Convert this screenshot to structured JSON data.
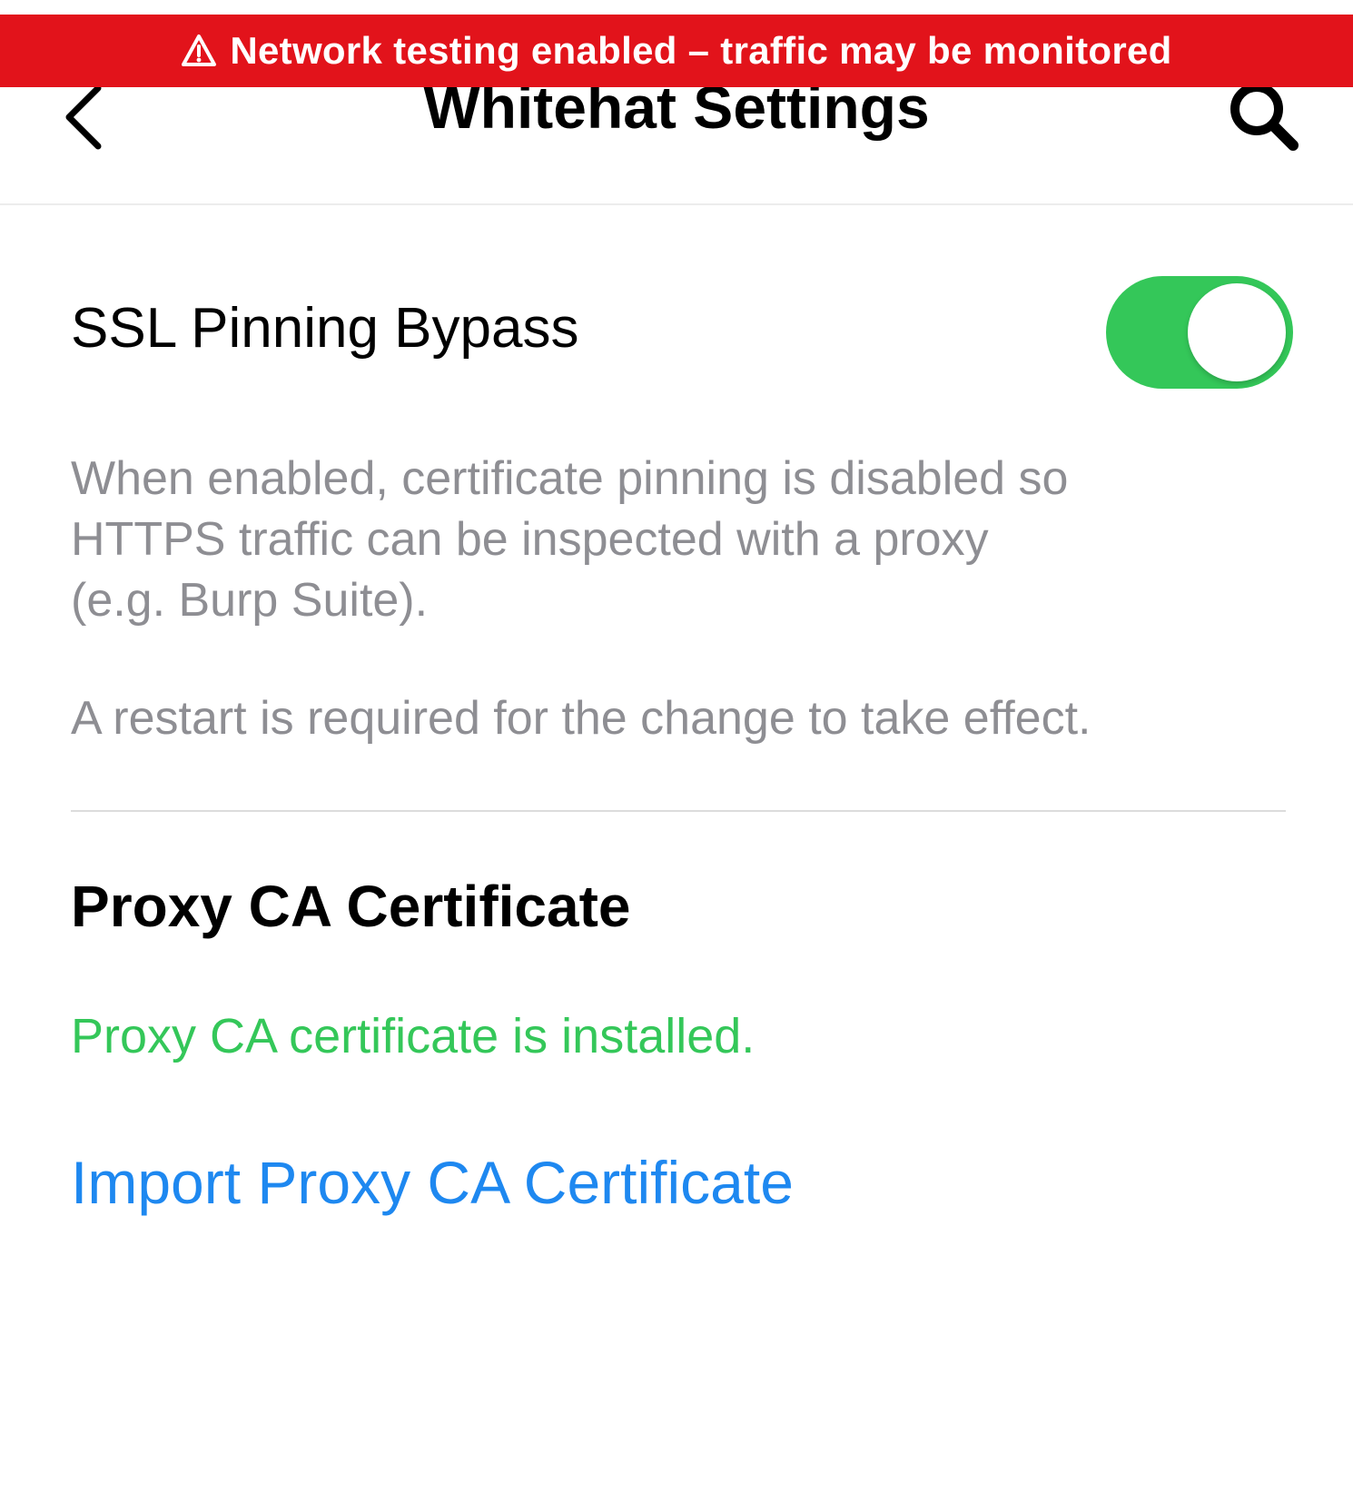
{
  "banner": {
    "text": "Network testing enabled – traffic may be monitored",
    "icon": "warning-triangle-icon",
    "background_color": "#e2131b"
  },
  "navbar": {
    "title": "Whitehat Settings",
    "back_icon": "chevron-left-icon",
    "search_icon": "search-icon"
  },
  "ssl_pinning": {
    "label": "SSL Pinning Bypass",
    "toggle_on": true,
    "toggle_color": "#34c759",
    "description_line1": "When enabled, certificate pinning is disabled so",
    "description_line2": "HTTPS traffic can be inspected with a proxy",
    "description_line3": "(e.g. Burp Suite).",
    "restart_note": "A restart is required for the change to take effect."
  },
  "proxy_ca": {
    "section_title": "Proxy CA Certificate",
    "status": "Proxy CA certificate is installed.",
    "status_color": "#34c759",
    "import_label": "Import Proxy CA Certificate",
    "link_color": "#1e88f0"
  }
}
